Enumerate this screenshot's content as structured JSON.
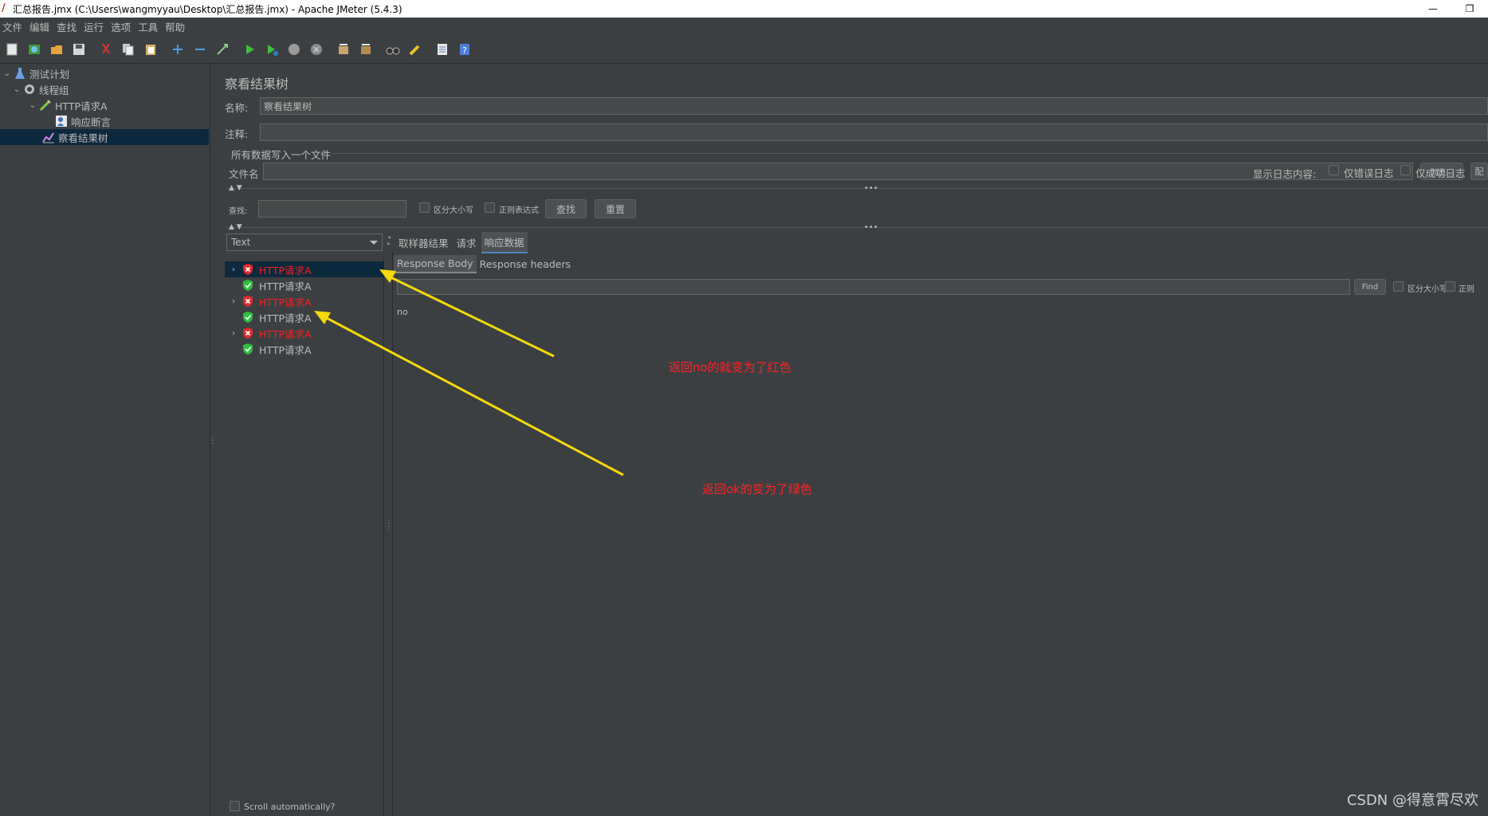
{
  "window": {
    "title": "汇总报告.jmx (C:\\Users\\wangmyyau\\Desktop\\汇总报告.jmx) - Apache JMeter (5.4.3)",
    "minimize": "—",
    "restore": "❐"
  },
  "menu": [
    "文件",
    "编辑",
    "查找",
    "运行",
    "选项",
    "工具",
    "帮助"
  ],
  "tree": {
    "items": [
      {
        "label": "测试计划",
        "icon": "flask-icon"
      },
      {
        "label": "线程组",
        "icon": "gear-icon"
      },
      {
        "label": "HTTP请求A",
        "icon": "pipette-icon"
      },
      {
        "label": "响应断言",
        "icon": "assertion-icon"
      },
      {
        "label": "察看结果树",
        "icon": "chart-icon"
      }
    ]
  },
  "panel": {
    "title": "察看结果树",
    "name_label": "名称:",
    "name_value": "察看结果树",
    "comment_label": "注释:",
    "comment_value": "",
    "write_all_label": "所有数据写入一个文件",
    "filename_label": "文件名",
    "filename_value": "",
    "browse_button": "浏览...",
    "log_content_label": "显示日志内容:",
    "errors_only_label": "仅错误日志",
    "success_only_label": "仅成功日志",
    "config_button": "配",
    "search_label": "查找:",
    "search_value": "",
    "case_sensitive_label": "区分大小写",
    "regex_label": "正则表达式",
    "find_button": "查找",
    "reset_button": "重置",
    "renderer_selected": "Text",
    "scroll_auto_label": "Scroll automatically?"
  },
  "results": [
    {
      "label": "HTTP请求A",
      "status": "fail",
      "expandable": true
    },
    {
      "label": "HTTP请求A",
      "status": "ok",
      "expandable": false
    },
    {
      "label": "HTTP请求A",
      "status": "fail",
      "expandable": true
    },
    {
      "label": "HTTP请求A",
      "status": "ok",
      "expandable": false
    },
    {
      "label": "HTTP请求A",
      "status": "fail",
      "expandable": true
    },
    {
      "label": "HTTP请求A",
      "status": "ok",
      "expandable": false
    }
  ],
  "detail": {
    "tabs": [
      "取样器结果",
      "请求",
      "响应数据"
    ],
    "active_tab": "响应数据",
    "subtabs": [
      "Response Body",
      "Response headers"
    ],
    "find_button": "Find",
    "case_label": "区分大小写",
    "regex_label": "正则",
    "body_text": "no"
  },
  "annotations": {
    "red_note": "返回no的就变为了红色",
    "green_note": "返回ok的变为了绿色",
    "arrow_color": "#f5d90a"
  },
  "watermark": "CSDN @得意霄尽欢",
  "colors": {
    "bg": "#3c3f41",
    "selection": "#0d293e",
    "fail_text": "#ff1a1a",
    "annotation_text": "#ff2020"
  }
}
